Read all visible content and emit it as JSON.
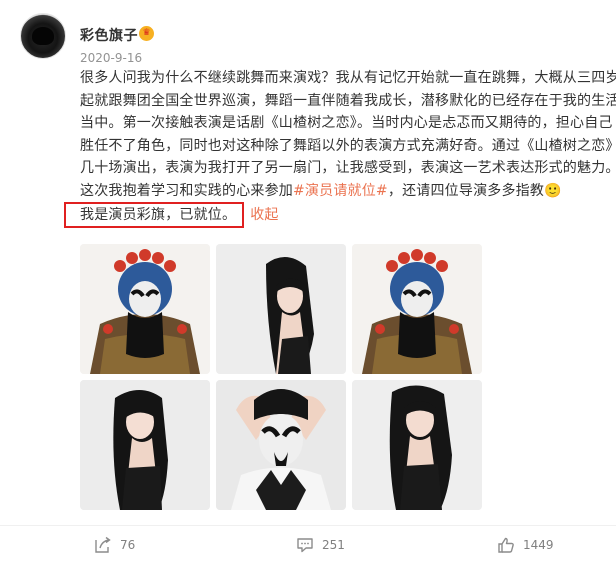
{
  "post": {
    "author": "彩色旗子",
    "badge_icon": "vip-crown-icon",
    "badge_glyph": "♛",
    "timestamp": "2020-9-16",
    "lines": [
      "很多人问我为什么不继续跳舞而来演戏？我从有记忆开始就一直在跳舞，大概从三四岁",
      "起就跟舞团全国全世界巡演，舞蹈一直伴随着我成长，潜移默化的已经存在于我的生活",
      "当中。第一次接触表演是话剧《山楂树之恋》。当时内心是忐忑而又期待的，担心自己",
      "胜任不了角色，同时也对这种除了舞蹈以外的表演方式充满好奇。通过《山楂树之恋》",
      "几十场演出，表演为我打开了另一扇门，让我感受到，表演这一艺术表达形式的魅力。"
    ],
    "line6_prefix": "这次我抱着学习和实践的心来参加",
    "hashtag": "#演员请就位#",
    "line6_suffix": "，还请四位导演多多指教🙂",
    "highlighted_sentence": "我是演员彩旗，已就位。",
    "collapse_label": "收起"
  },
  "images": [
    {
      "subject": "peking-opera-mask"
    },
    {
      "subject": "portrait-dark-hair"
    },
    {
      "subject": "peking-opera-mask"
    },
    {
      "subject": "portrait-dark-hair"
    },
    {
      "subject": "painted-face-hands-on-head"
    },
    {
      "subject": "portrait-dark-hair"
    }
  ],
  "actions": {
    "repost_icon": "share-icon",
    "repost_count": "76",
    "comment_icon": "comment-icon",
    "comment_count": "251",
    "like_icon": "thumbs-up-icon",
    "like_count": "1449"
  },
  "colors": {
    "accent": "#eb7350",
    "highlight_border": "#e02020",
    "meta_gray": "#939393"
  }
}
